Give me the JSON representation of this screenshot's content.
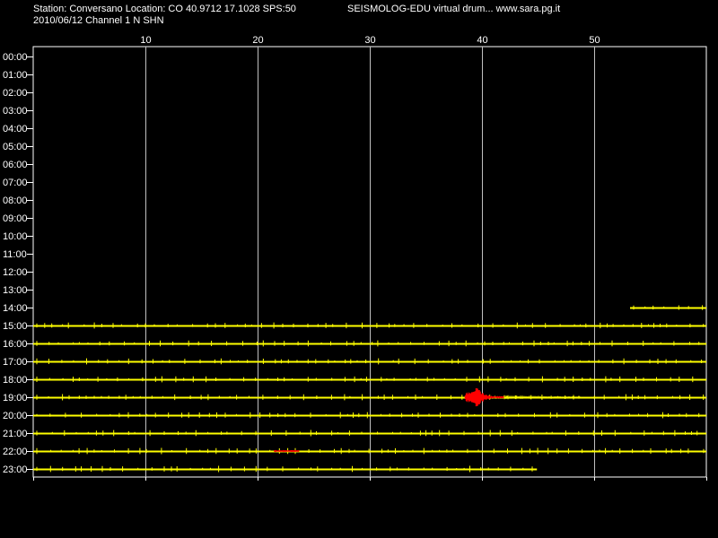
{
  "header": {
    "line1": "Station: Conversano Location: CO 40.9712 17.1028 SPS:50",
    "line1_right": "SEISMOLOG-EDU virtual drum... www.sara.pg.it",
    "line2": "2010/06/12  Channel 1 N SHN"
  },
  "chart_data": {
    "type": "line",
    "title": "",
    "xlabel": "",
    "ylabel": "",
    "xlim": [
      0,
      60
    ],
    "x_ticks": [
      10,
      20,
      30,
      40,
      50
    ],
    "x_tick_labels": [
      "10",
      "20",
      "30",
      "40",
      "50"
    ],
    "y_tick_labels": [
      "00:00",
      "01:00",
      "02:00",
      "03:00",
      "04:00",
      "05:00",
      "06:00",
      "07:00",
      "08:00",
      "09:00",
      "10:00",
      "11:00",
      "12:00",
      "13:00",
      "14:00",
      "15:00",
      "16:00",
      "17:00",
      "18:00",
      "19:00",
      "20:00",
      "21:00",
      "22:00",
      "23:00"
    ],
    "grid": true,
    "colors": {
      "background": "#000000",
      "frame": "#ffffff",
      "grid": "#c0c0c0",
      "trace": "#ffff00",
      "event": "#ff0000"
    },
    "traces": [
      {
        "hour": "14:00",
        "start_min": 53.2,
        "end_min": 60
      },
      {
        "hour": "15:00",
        "start_min": 0,
        "end_min": 60
      },
      {
        "hour": "16:00",
        "start_min": 0,
        "end_min": 60
      },
      {
        "hour": "17:00",
        "start_min": 0,
        "end_min": 60
      },
      {
        "hour": "18:00",
        "start_min": 0,
        "end_min": 60
      },
      {
        "hour": "19:00",
        "start_min": 0,
        "end_min": 60
      },
      {
        "hour": "20:00",
        "start_min": 0,
        "end_min": 60
      },
      {
        "hour": "21:00",
        "start_min": 0,
        "end_min": 60
      },
      {
        "hour": "22:00",
        "start_min": 0,
        "end_min": 60
      },
      {
        "hour": "23:00",
        "start_min": 0,
        "end_min": 44.9
      }
    ],
    "events": [
      {
        "hour": "19:00",
        "start_min": 38.5,
        "end_min": 42.0,
        "color": "red"
      },
      {
        "hour": "22:00",
        "start_min": 21.5,
        "end_min": 23.7,
        "color": "red"
      }
    ]
  }
}
